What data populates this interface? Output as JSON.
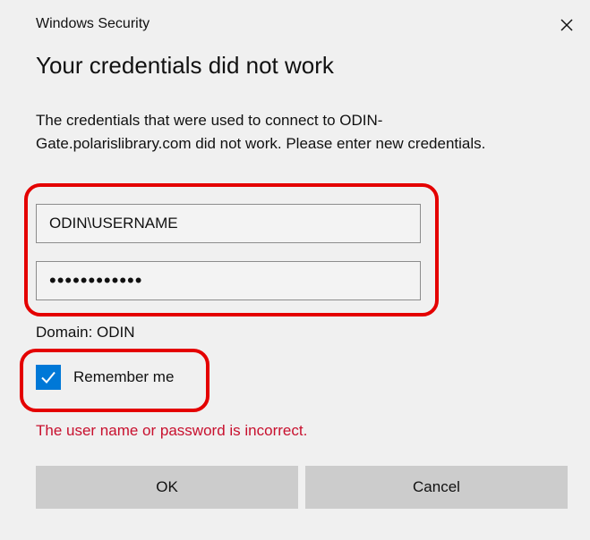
{
  "window": {
    "title": "Windows Security",
    "close_icon": "close-icon"
  },
  "dialog": {
    "heading": "Your credentials did not work",
    "message": "The credentials that were used to connect to ODIN-Gate.polarislibrary.com did not work. Please enter new credentials."
  },
  "credentials": {
    "username_value": "ODIN\\USERNAME",
    "password_value": "••••••••••••",
    "domain_text": "Domain: ODIN"
  },
  "remember": {
    "label": "Remember me",
    "checked": true,
    "check_icon": "checkmark-icon"
  },
  "error": {
    "text": "The user name or password is incorrect."
  },
  "buttons": {
    "ok_label": "OK",
    "cancel_label": "Cancel"
  },
  "colors": {
    "background": "#f0f0f0",
    "accent": "#0078d7",
    "error": "#c8102e",
    "highlight": "#e40000",
    "button": "#cccccc"
  }
}
